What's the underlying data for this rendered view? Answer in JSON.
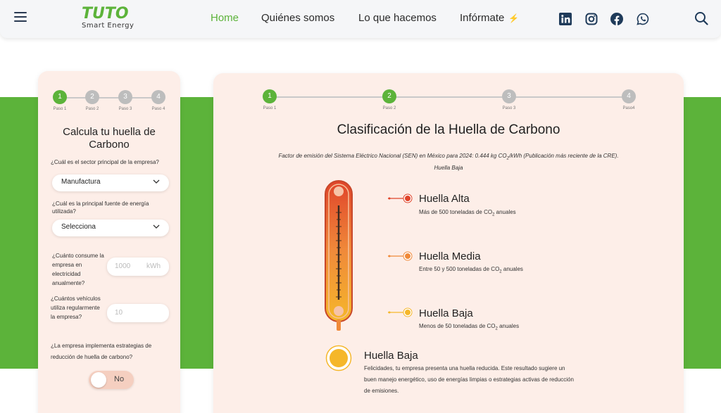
{
  "header": {
    "logo_main": "TUTO",
    "logo_sub": "Smart Energy",
    "nav": [
      {
        "label": "Home",
        "active": true
      },
      {
        "label": "Quiénes somos",
        "active": false
      },
      {
        "label": "Lo que hacemos",
        "active": false
      },
      {
        "label": "Infórmate",
        "active": false
      }
    ],
    "bolt_icon": "⚡",
    "social": [
      "linkedin-icon",
      "instagram-icon",
      "facebook-icon",
      "whatsapp-icon"
    ]
  },
  "colors": {
    "brand_green": "#5cb33a",
    "card_bg": "#fdeee8",
    "high": "#e0442a",
    "medium": "#f08a3a",
    "low": "#f5b72a"
  },
  "form": {
    "steps": [
      {
        "num": "1",
        "label": "Paso 1",
        "done": true
      },
      {
        "num": "2",
        "label": "Paso 2",
        "done": false
      },
      {
        "num": "3",
        "label": "Paso 3",
        "done": false
      },
      {
        "num": "4",
        "label": "Paso 4",
        "done": false
      }
    ],
    "title": "Calcula tu huella de Carbono",
    "q_sector": "¿Cuál es el sector principal de la empresa?",
    "sector_value": "Manufactura",
    "q_energy_source": "¿Cuál es la principal fuente de energía utilizada?",
    "energy_source_value": "Selecciona",
    "q_consumption": "¿Cuánto consume la empresa en electricidad anualmente?",
    "consumption_placeholder": "1000",
    "consumption_unit": "kWh",
    "q_vehicles": "¿Cuántos vehículos utiliza regularmente la empresa?",
    "vehicles_placeholder": "10",
    "q_strategies": "¿La empresa implementa estrategias de reducción de huella de carbono?",
    "toggle_label": "No"
  },
  "result": {
    "steps": [
      {
        "num": "1",
        "label": "Paso 1",
        "done": true
      },
      {
        "num": "2",
        "label": "Paso 2",
        "done": true
      },
      {
        "num": "3",
        "label": "Paso 3",
        "done": false
      },
      {
        "num": "4",
        "label": "Paso4",
        "done": false
      }
    ],
    "title": "Clasificación de la Huella de Carbono",
    "factor_pre": "Factor de emisión del Sistema Eléctrico Nacional (SEN) en México para 2024: 0.444 kg CO",
    "factor_sub": "2",
    "factor_post": "/kWh (Publicación más reciente de la CRE).",
    "factor_level": "Huella Baja",
    "levels": [
      {
        "title": "Huella Alta",
        "desc_pre": "Más de 500 toneladas de CO",
        "sub": "2",
        "desc_post": " anuales"
      },
      {
        "title": "Huella Media",
        "desc_pre": "Entre 50 y 500 toneladas de CO",
        "sub": "2",
        "desc_post": " anuales"
      },
      {
        "title": "Huella Baja",
        "desc_pre": "Menos de 50 toneladas de CO",
        "sub": "2",
        "desc_post": " anuales"
      }
    ],
    "result_title": "Huella Baja",
    "result_desc": "Felicidades, tu empresa presenta una huella reducida. Este resultado sugiere un buen manejo energético, uso de energías limpias o estrategias activas de reducción de emisiones."
  }
}
